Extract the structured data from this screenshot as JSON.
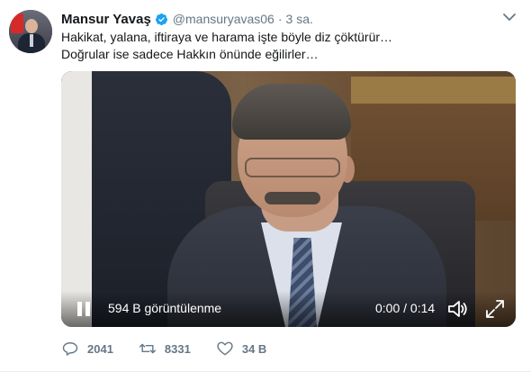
{
  "tweet": {
    "author_name": "Mansur Yavaş",
    "handle": "@mansuryavas06",
    "separator": "·",
    "timestamp": "3 sa.",
    "text_line_1": "Hakikat, yalana, iftiraya ve harama işte böyle diz çöktürür…",
    "text_line_2": "Doğrular ise sadece Hakkın önünde eğilirler…",
    "verified": true
  },
  "media": {
    "type": "video",
    "views": "594 B görüntülenme",
    "timecode": "0:00 / 0:14",
    "state": "playing"
  },
  "actions": {
    "reply_count": "2041",
    "retweet_count": "8331",
    "like_count": "34 B"
  },
  "icons": {
    "verified": "verified-badge-icon",
    "caret": "chevron-down-icon",
    "pause": "pause-icon",
    "volume": "volume-icon",
    "fullscreen": "fullscreen-icon",
    "reply": "reply-icon",
    "retweet": "retweet-icon",
    "like": "heart-icon"
  },
  "colors": {
    "accent": "#1da1f2",
    "secondary_text": "#657786",
    "primary_text": "#14171a"
  }
}
